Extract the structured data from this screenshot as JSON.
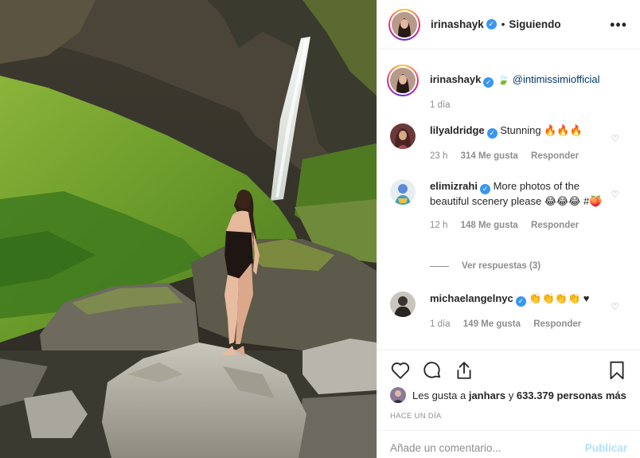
{
  "post": {
    "author": "irinashayk",
    "follow_status": "Siguiendo",
    "more_glyph": "•••"
  },
  "caption": {
    "author": "irinashayk",
    "emoji": "🍃",
    "text": "@intimissimiofficial",
    "time": "1 día"
  },
  "comments": [
    {
      "author": "lilyaldridge",
      "text": "Stunning 🔥🔥🔥",
      "time": "23 h",
      "likes": "314 Me gusta",
      "reply": "Responder"
    },
    {
      "author": "elimizrahi",
      "text": "More photos of the beautiful scenery please 😂😂😂 #🍑",
      "time": "12 h",
      "likes": "148 Me gusta",
      "reply": "Responder"
    },
    {
      "author": "michaelangelnyc",
      "text": "👏👏👏👏 ♥",
      "time": "1 día",
      "likes": "149 Me gusta",
      "reply": "Responder"
    }
  ],
  "view_replies": "Ver respuestas (3)",
  "likes": {
    "prefix": "Les gusta a",
    "user": "janhars",
    "connector": "y",
    "count": "633.379 personas más"
  },
  "timestamp": "HACE UN DÍA",
  "add_comment": {
    "placeholder": "Añade un comentario...",
    "publish": "Publicar"
  },
  "icons": {
    "verified": "verified-badge-icon",
    "heart": "heart-icon",
    "comment": "comment-icon",
    "share": "share-icon",
    "save": "bookmark-icon"
  },
  "colors": {
    "accent": "#3897f0",
    "muted": "#8e8e8e",
    "publish_disabled": "#b2dffc"
  }
}
